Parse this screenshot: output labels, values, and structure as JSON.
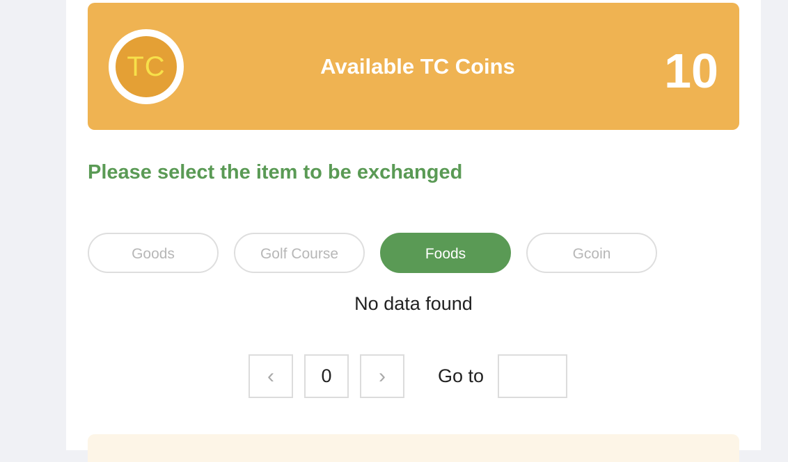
{
  "coin_card": {
    "badge_text": "TC",
    "title": "Available TC Coins",
    "value": "10",
    "colors": {
      "card_bg": "#efb352",
      "badge_bg": "#e4a035",
      "badge_text": "#f7e04a"
    }
  },
  "instruction": "Please select the item to be exchanged",
  "tabs": [
    {
      "label": "Goods",
      "active": false
    },
    {
      "label": "Golf Course",
      "active": false
    },
    {
      "label": "Foods",
      "active": true
    },
    {
      "label": "Gcoin",
      "active": false
    }
  ],
  "empty_message": "No data found",
  "pagination": {
    "prev_icon": "chevron-left-icon",
    "prev_glyph": "‹",
    "current_page": "0",
    "next_icon": "chevron-right-icon",
    "next_glyph": "›",
    "goto_label": "Go to",
    "goto_value": ""
  },
  "colors": {
    "accent_green": "#5a9a55",
    "page_bg": "#f0f1f5"
  }
}
